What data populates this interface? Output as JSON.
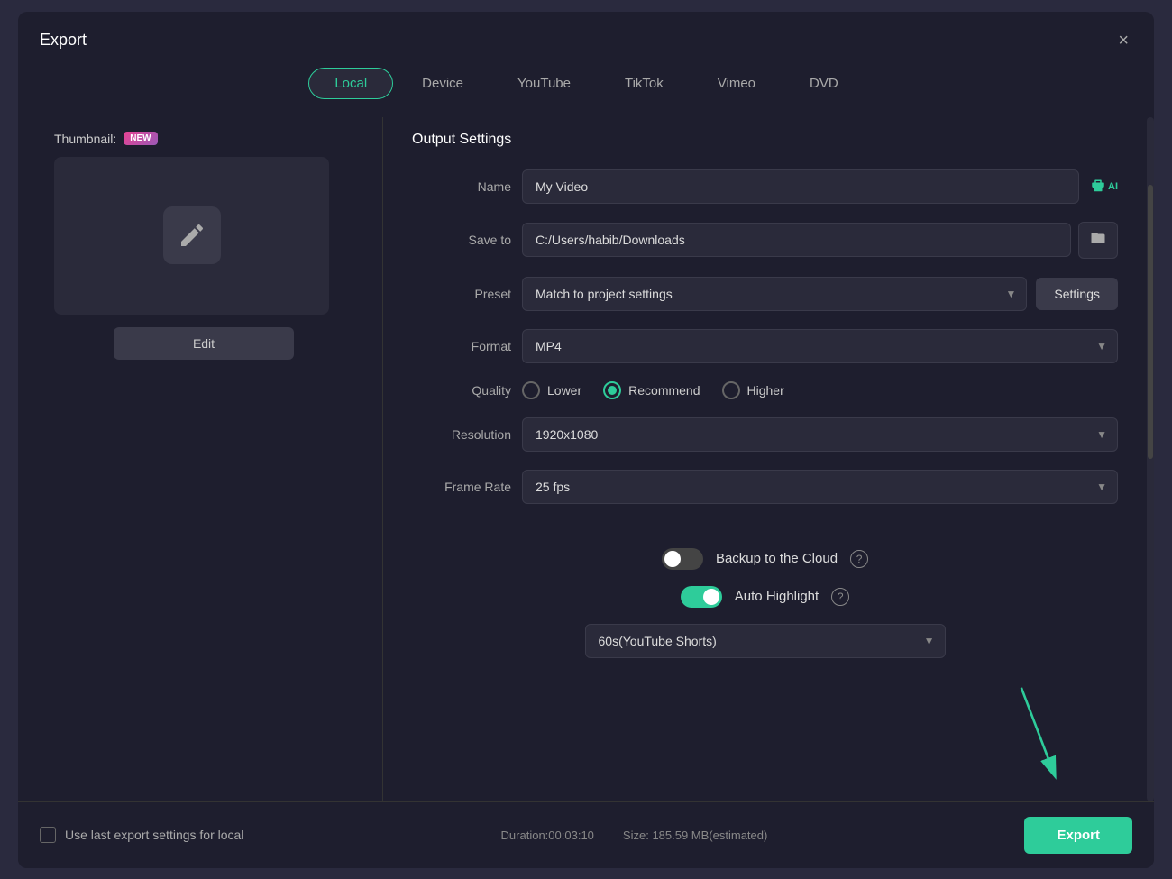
{
  "dialog": {
    "title": "Export",
    "close_label": "×"
  },
  "tabs": [
    {
      "id": "local",
      "label": "Local",
      "active": true
    },
    {
      "id": "device",
      "label": "Device",
      "active": false
    },
    {
      "id": "youtube",
      "label": "YouTube",
      "active": false
    },
    {
      "id": "tiktok",
      "label": "TikTok",
      "active": false
    },
    {
      "id": "vimeo",
      "label": "Vimeo",
      "active": false
    },
    {
      "id": "dvd",
      "label": "DVD",
      "active": false
    }
  ],
  "left": {
    "thumbnail_label": "Thumbnail:",
    "new_badge": "NEW",
    "edit_button": "Edit"
  },
  "right": {
    "section_title": "Output Settings",
    "name_label": "Name",
    "name_value": "My Video",
    "save_to_label": "Save to",
    "save_to_value": "C:/Users/habib/Downloads",
    "preset_label": "Preset",
    "preset_value": "Match to project settings",
    "settings_btn": "Settings",
    "format_label": "Format",
    "format_value": "MP4",
    "quality_label": "Quality",
    "quality_options": [
      {
        "id": "lower",
        "label": "Lower",
        "selected": false
      },
      {
        "id": "recommend",
        "label": "Recommend",
        "selected": true
      },
      {
        "id": "higher",
        "label": "Higher",
        "selected": false
      }
    ],
    "resolution_label": "Resolution",
    "resolution_value": "1920x1080",
    "frame_rate_label": "Frame Rate",
    "frame_rate_value": "25 fps",
    "backup_label": "Backup to the Cloud",
    "backup_on": false,
    "auto_highlight_label": "Auto Highlight",
    "auto_highlight_on": true,
    "shorts_value": "60s(YouTube Shorts)"
  },
  "footer": {
    "use_last_settings": "Use last export settings for local",
    "duration_label": "Duration:",
    "duration_value": "00:03:10",
    "size_label": "Size:",
    "size_value": "185.59 MB(estimated)",
    "export_btn": "Export"
  },
  "colors": {
    "accent": "#2ecc9a",
    "bg": "#1e1e2e",
    "bg2": "#2a2a3a"
  }
}
